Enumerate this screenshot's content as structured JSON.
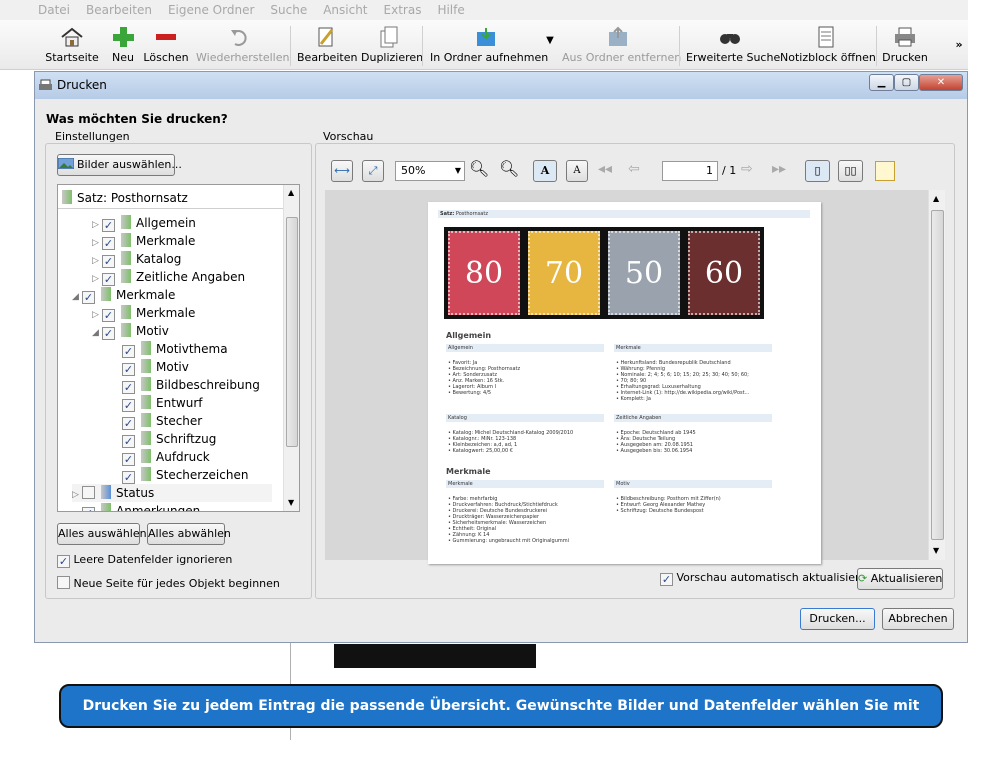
{
  "menu": [
    "Datei",
    "Bearbeiten",
    "Eigene Ordner",
    "Suche",
    "Ansicht",
    "Extras",
    "Hilfe"
  ],
  "toolbar": {
    "home": "Startseite",
    "new": "Neu",
    "delete": "Löschen",
    "restore": "Wiederherstellen",
    "edit": "Bearbeiten",
    "duplicate": "Duplizieren",
    "add_folder": "In Ordner aufnehmen",
    "remove_folder": "Aus Ordner entfernen",
    "adv_search": "Erweiterte Suche",
    "notepad": "Notizblock öffnen",
    "print": "Drucken",
    "more": "»"
  },
  "dialog": {
    "title": "Drucken",
    "heading": "Was möchten Sie drucken?",
    "settings": "Einstellungen",
    "preview": "Vorschau",
    "select_images": "Bilder auswählen...",
    "select_all": "Alles auswählen",
    "deselect_all": "Alles abwählen",
    "ignore_empty": "Leere Datenfelder ignorieren",
    "new_page": "Neue Seite für jedes Objekt beginnen",
    "auto_update": "Vorschau automatisch aktualisieren",
    "refresh": "Aktualisieren",
    "print_btn": "Drucken...",
    "cancel": "Abbrechen"
  },
  "tree": {
    "root": "Satz: Posthornsatz",
    "rows": [
      {
        "label": "Allgemein",
        "checked": true,
        "expand": "▷"
      },
      {
        "label": "Merkmale",
        "checked": true,
        "expand": "▷"
      },
      {
        "label": "Katalog",
        "checked": true,
        "expand": "▷"
      },
      {
        "label": "Zeitliche Angaben",
        "checked": true,
        "expand": "▷"
      },
      {
        "label": "Merkmale",
        "checked": true,
        "expand": "◢"
      },
      {
        "label": "Merkmale",
        "checked": true,
        "expand": "▷"
      },
      {
        "label": "Motiv",
        "checked": true,
        "expand": "◢"
      },
      {
        "label": "Motivthema",
        "checked": true,
        "expand": ""
      },
      {
        "label": "Motiv",
        "checked": true,
        "expand": ""
      },
      {
        "label": "Bildbeschreibung",
        "checked": true,
        "expand": ""
      },
      {
        "label": "Entwurf",
        "checked": true,
        "expand": ""
      },
      {
        "label": "Stecher",
        "checked": true,
        "expand": ""
      },
      {
        "label": "Schriftzug",
        "checked": true,
        "expand": ""
      },
      {
        "label": "Aufdruck",
        "checked": true,
        "expand": ""
      },
      {
        "label": "Stecherzeichen",
        "checked": true,
        "expand": ""
      },
      {
        "label": "Status",
        "checked": false,
        "expand": "▷"
      },
      {
        "label": "Anmerkungen",
        "checked": true,
        "expand": ""
      }
    ]
  },
  "zoom": {
    "value": "50%",
    "page": "1",
    "total": "/ 1"
  },
  "preview": {
    "satz": "Satz:",
    "satz_val": "Posthornsatz",
    "stamps": [
      {
        "value": "80",
        "color": "#d0475a"
      },
      {
        "value": "70",
        "color": "#e6b640"
      },
      {
        "value": "50",
        "color": "#9aa3ad"
      },
      {
        "value": "60",
        "color": "#6a2f2e"
      }
    ],
    "sec1": "Allgemein",
    "sec2": "Merkmale",
    "b1": "Allgemein",
    "b2": "Merkmale",
    "b3": "Katalog",
    "b4": "Zeitliche Angaben",
    "b5": "Merkmale",
    "b6": "Motiv",
    "l1": [
      "Favorit: Ja",
      "Bezeichnung: Posthornsatz",
      "Art: Sonderzusatz",
      "Anz. Marken: 16 Stk.",
      "Lagerort: Album I",
      "Bewertung: 4/5"
    ],
    "l2": [
      "Herkunftsland: Bundesrepublik Deutschland",
      "Währung: Pfennig",
      "Nominale: 2; 4; 5; 6; 10; 15; 20; 25; 30; 40; 50; 60;",
      "70; 80; 90",
      "Erhaltungsgrad: Luxuserhaltung",
      "Internet-Link (1): http://de.wikipedia.org/wiki/Post...",
      "Komplett: Ja"
    ],
    "l3": [
      "Katalog: Michel Deutschland-Katalog 2009/2010",
      "Katalognr.: MiNr. 123-138",
      "Kleinbezeichen: a,d, ad, 1",
      "Katalogwert: 25,00,00 €"
    ],
    "l4": [
      "Epoche: Deutschland ab 1945",
      "Ära: Deutsche Teilung",
      "Ausgegeben am: 20.08.1951",
      "Ausgegeben bis: 30.06.1954"
    ],
    "l5": [
      "Farbe: mehrfarbig",
      "Druckverfahren: Buchdruck/Stichtiefdruck",
      "Druckerei: Deutsche Bundesdruckerei",
      "Druckträger: Wasserzeichenpapier",
      "Sicherheitsmerkmale: Wasserzeichen",
      "Echtheit: Original",
      "Zähnung: K 14",
      "Gummierung: ungebraucht mit Originalgummi"
    ],
    "l6": [
      "Bildbeschreibung: Posthorn mit Ziffer(n)",
      "Entwurf: Georg Alexander Mathey",
      "Schriftzug: Deutsche Bundespost"
    ]
  },
  "tip": "Drucken Sie zu jedem Eintrag die passende Übersicht. Gewünschte Bilder und Datenfelder wählen Sie mit einem Klick."
}
